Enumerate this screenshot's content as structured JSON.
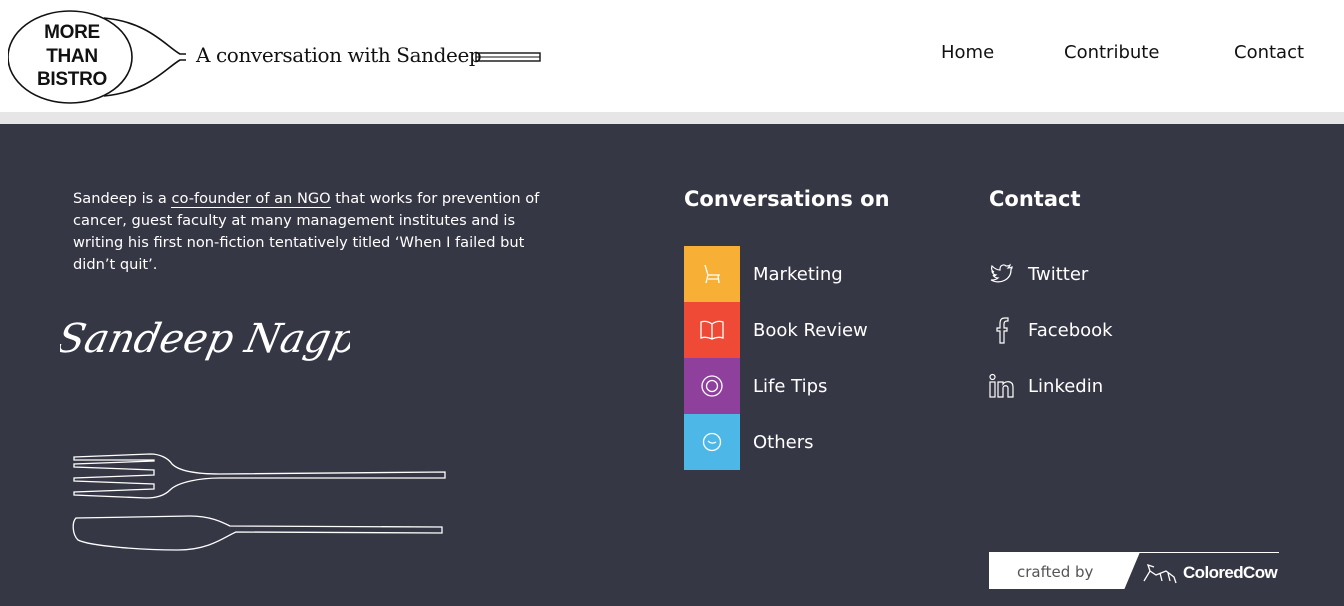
{
  "header": {
    "logo_lines": [
      "MORE",
      "THAN",
      "BISTRO"
    ],
    "tagline": "A conversation with Sandeep",
    "nav": [
      "Home",
      "Contribute",
      "Contact"
    ]
  },
  "about": {
    "prefix": "Sandeep is a ",
    "link": "co-founder of an NGO",
    "suffix": " that works for prevention of cancer, guest faculty at many management institutes and is writing his first non-fiction tentatively titled ‘When I failed but didn’t quit’.",
    "signature": "Sandeep Nagpal"
  },
  "conversations": {
    "title": "Conversations on",
    "items": [
      {
        "label": "Marketing",
        "color": "#F7B035",
        "icon": "chair-icon"
      },
      {
        "label": "Book Review",
        "color": "#EE4A36",
        "icon": "book-icon"
      },
      {
        "label": "Life Tips",
        "color": "#8F3F9C",
        "icon": "circle-icon"
      },
      {
        "label": "Others",
        "color": "#4DB8E7",
        "icon": "bowl-icon"
      }
    ]
  },
  "contact": {
    "title": "Contact",
    "items": [
      {
        "label": "Twitter",
        "icon": "twitter-icon"
      },
      {
        "label": "Facebook",
        "icon": "facebook-icon"
      },
      {
        "label": "Linkedin",
        "icon": "linkedin-icon"
      }
    ]
  },
  "crafted": {
    "text": "crafted by",
    "brand": "ColoredCow"
  },
  "colors": {
    "footer_bg": "#363745",
    "header_bg": "#FFFFFF"
  }
}
